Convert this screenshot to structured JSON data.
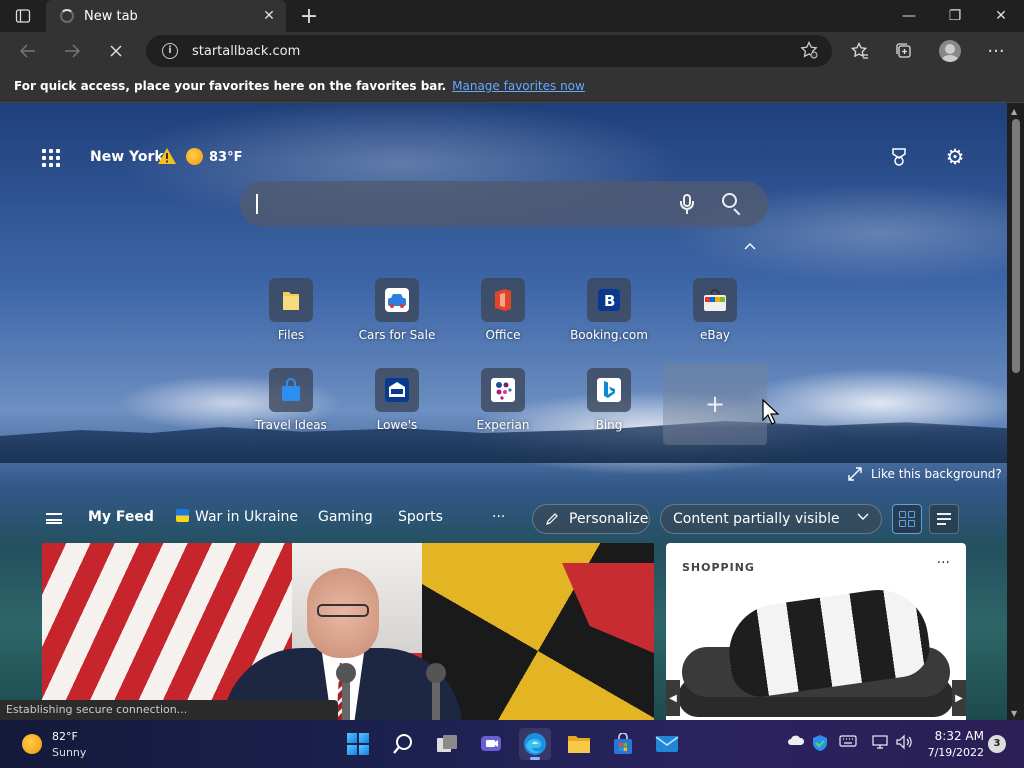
{
  "browser": {
    "tab": {
      "title": "New tab",
      "close_glyph": "✕"
    },
    "new_tab_glyph": "+",
    "window": {
      "minimize": "—",
      "restore": "❐",
      "close": "✕"
    },
    "address": {
      "url": "startallback.com",
      "info_glyph": "i"
    },
    "favorites_notice": {
      "message": "For quick access, place your favorites here on the favorites bar.",
      "link": "Manage favorites now"
    },
    "status": "Establishing secure connection..."
  },
  "ntp": {
    "weather": {
      "city": "New York",
      "temp": "83°F"
    },
    "search": {
      "placeholder": ""
    },
    "quick_links": [
      {
        "label": "Files",
        "icon": "folder-icon"
      },
      {
        "label": "Cars for Sale",
        "icon": "car-icon"
      },
      {
        "label": "Office",
        "icon": "office-icon"
      },
      {
        "label": "Booking.com",
        "icon": "booking-icon"
      },
      {
        "label": "eBay",
        "icon": "ebay-bag-icon"
      },
      {
        "label": "Travel Ideas",
        "icon": "shopping-bag-icon"
      },
      {
        "label": "Lowe's",
        "icon": "lowes-icon"
      },
      {
        "label": "Experian",
        "icon": "experian-icon"
      },
      {
        "label": "Bing",
        "icon": "bing-icon"
      }
    ],
    "add_link_glyph": "+",
    "like_background": "Like this background?",
    "feed": {
      "tabs": [
        "My Feed",
        "War in Ukraine",
        "Gaming",
        "Sports"
      ],
      "more": "···",
      "personalize": "Personalize",
      "visibility": "Content partially visible"
    },
    "shopping_card": {
      "label": "SHOPPING",
      "more": "···"
    }
  },
  "taskbar": {
    "weather": {
      "temp": "82°F",
      "condition": "Sunny"
    },
    "clock": {
      "time": "8:32 AM",
      "date": "7/19/2022"
    },
    "notifications": "3"
  },
  "colors": {
    "accent_link": "#65a8ff",
    "warning": "#f3c21b",
    "active_layout": "#5aa0f0"
  }
}
